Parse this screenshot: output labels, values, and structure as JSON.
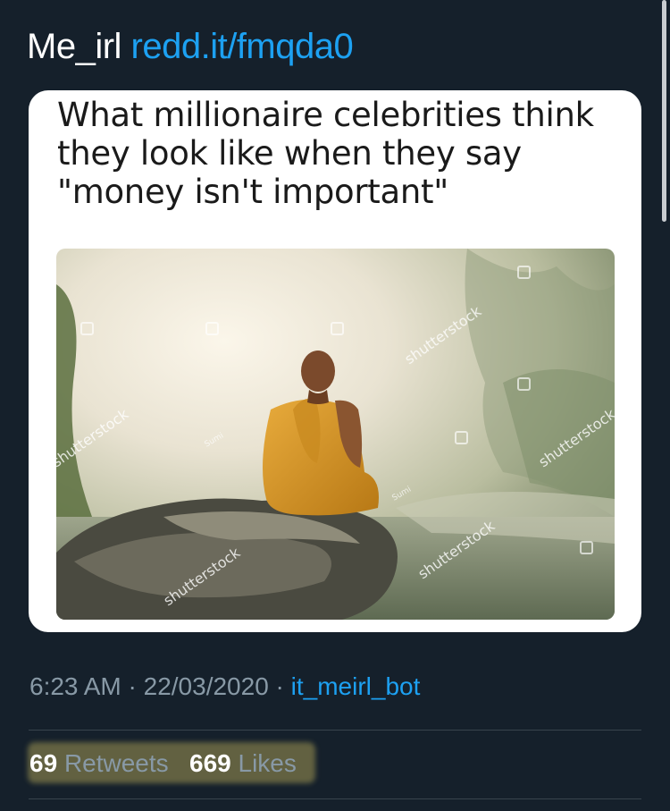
{
  "tweet": {
    "text_prefix": "Me_irl",
    "link": "redd.it/fmqda0"
  },
  "meme": {
    "caption": "What millionaire celebrities think they look like when they say \"money isn't important\"",
    "watermark_text": "shutterstock",
    "photographer_mark": "Sumi"
  },
  "meta": {
    "time": "6:23 AM",
    "separator": "·",
    "date": "22/03/2020",
    "via": "it_meirl_bot"
  },
  "stats": {
    "retweets_count": "69",
    "retweets_label": "Retweets",
    "likes_count": "669",
    "likes_label": "Likes"
  },
  "colors": {
    "background": "#15202b",
    "link": "#1da1f2",
    "secondary_text": "#8899a6",
    "highlight": "#cdbc5f"
  }
}
